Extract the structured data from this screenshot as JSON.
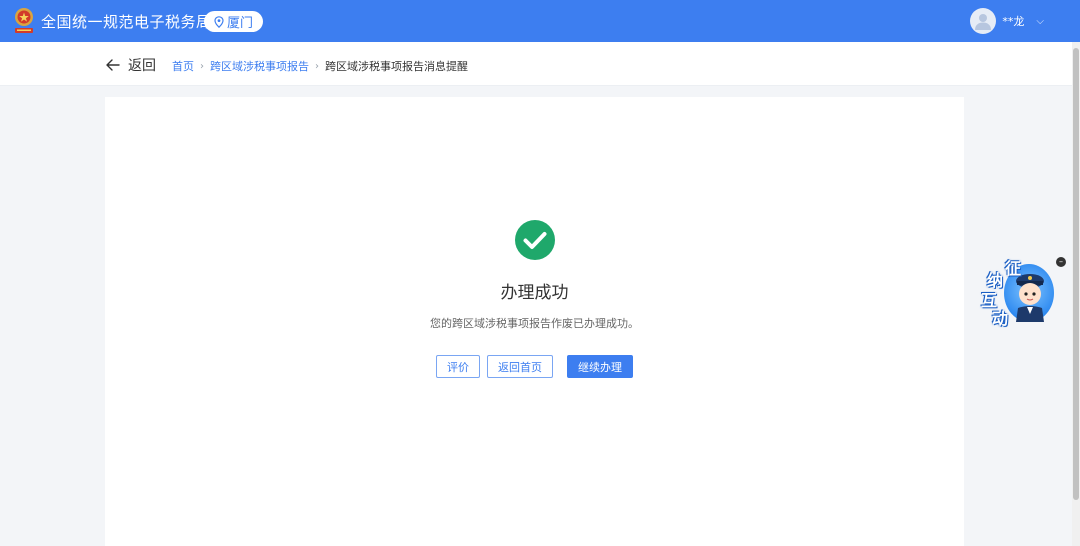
{
  "header": {
    "title": "全国统一规范电子税务局",
    "city": "厦门",
    "user_name": "**龙",
    "emblem_icon": "tax-emblem-icon",
    "brand_color": "#3d7ef0"
  },
  "nav": {
    "back_label": "返回",
    "breadcrumbs": [
      {
        "label": "首页"
      },
      {
        "label": "跨区域涉税事项报告"
      },
      {
        "label": "跨区域涉税事项报告消息提醒"
      }
    ]
  },
  "result": {
    "title": "办理成功",
    "description": "您的跨区域涉税事项报告作废已办理成功。",
    "success_color": "#1fa86b"
  },
  "actions": {
    "rate_label": "评价",
    "home_label": "返回首页",
    "continue_label": "继续办理"
  },
  "assistant": {
    "chars": [
      "征",
      "纳",
      "互",
      "动"
    ],
    "close_symbol": "–"
  }
}
